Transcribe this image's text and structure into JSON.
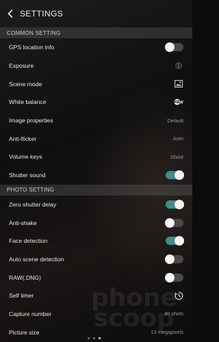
{
  "header": {
    "title": "SETTINGS"
  },
  "sections": {
    "common": {
      "title": "COMMON SETTING"
    },
    "photo": {
      "title": "PHOTO SETTING"
    }
  },
  "common_items": [
    {
      "label": "GPS location info",
      "type": "toggle",
      "state": "off"
    },
    {
      "label": "Exposure",
      "type": "icon",
      "icon": "exposure-icon"
    },
    {
      "label": "Scene mode",
      "type": "icon",
      "icon": "scene-image-icon"
    },
    {
      "label": "White balance",
      "type": "icon",
      "icon": "auto-white-balance-icon",
      "icon_text": "AW"
    },
    {
      "label": "Image properties",
      "type": "value",
      "value": "Default"
    },
    {
      "label": "Anti-flicker",
      "type": "value",
      "value": "Auto"
    },
    {
      "label": "Volume keys",
      "type": "value",
      "value": "Shoot"
    },
    {
      "label": "Shutter sound",
      "type": "toggle",
      "state": "on"
    }
  ],
  "photo_items": [
    {
      "label": "Zero shutter delay",
      "type": "toggle",
      "state": "on"
    },
    {
      "label": "Anti-shake",
      "type": "toggle",
      "state": "off"
    },
    {
      "label": "Face detection",
      "type": "toggle",
      "state": "on"
    },
    {
      "label": "Auto scene detection",
      "type": "toggle",
      "state": "off"
    },
    {
      "label": "RAW(.DNG)",
      "type": "toggle",
      "state": "off"
    },
    {
      "label": "Self timer",
      "type": "icon",
      "icon": "timer-icon"
    },
    {
      "label": "Capture number",
      "type": "value",
      "value": "40 shots"
    },
    {
      "label": "Picture size",
      "type": "value",
      "value": "13 megapixels"
    }
  ],
  "watermark": {
    "line1": "phone",
    "line2": "scoop"
  },
  "colors": {
    "toggle_on": "#3f8f86",
    "toggle_off": "#4a4a4a",
    "section_bg": "#464646"
  },
  "pager": {
    "count": 3,
    "active_index": 2
  }
}
